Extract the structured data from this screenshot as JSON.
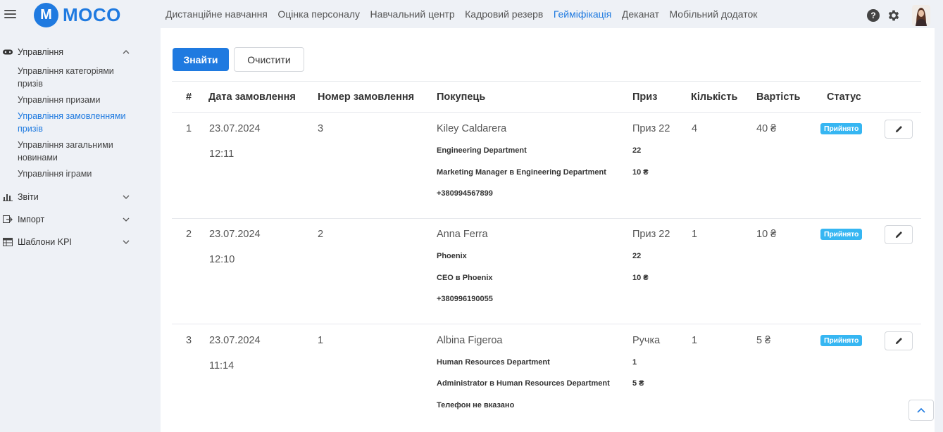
{
  "app": {
    "logo_letter": "M",
    "logo_text": "MOCO"
  },
  "topnav": [
    {
      "label": "Дистанційне навчання",
      "active": false
    },
    {
      "label": "Оцінка персоналу",
      "active": false
    },
    {
      "label": "Навчальний центр",
      "active": false
    },
    {
      "label": "Кадровий резерв",
      "active": false
    },
    {
      "label": "Гейміфікація",
      "active": true
    },
    {
      "label": "Деканат",
      "active": false
    },
    {
      "label": "Мобільний додаток",
      "active": false
    }
  ],
  "top_icons": {
    "help": "?"
  },
  "sidebar": {
    "management": {
      "label": "Управління",
      "items": [
        "Управління категоріями призів",
        "Управління призами",
        "Управління замовленнями призів",
        "Управління загальними новинами",
        "Управління іграми"
      ]
    },
    "reports": "Звіти",
    "import": "Імпорт",
    "kpi": "Шаблони KPI"
  },
  "filters": {
    "find_label": "Знайти",
    "clear_label": "Очистити"
  },
  "table": {
    "headers": [
      "#",
      "Дата замовлення",
      "Номер замовлення",
      "Покупець",
      "Приз",
      "Кількість",
      "Вартість",
      "Статус"
    ],
    "rows": [
      {
        "num": "1",
        "date": "23.07.2024",
        "time": "12:11",
        "order": "3",
        "buyer": "Kiley Caldarera",
        "dept": "Engineering Department",
        "position": "Marketing Manager в Engineering Department",
        "phone": "+380994567899",
        "prize": "Приз 22",
        "prize_sub1": "22",
        "prize_sub2": "10 ₴",
        "qty": "4",
        "cost": "40 ₴",
        "status": "Прийнято"
      },
      {
        "num": "2",
        "date": "23.07.2024",
        "time": "12:10",
        "order": "2",
        "buyer": "Anna Ferra",
        "dept": "Phoenix",
        "position": "CEO в Phoenix",
        "phone": "+380996190055",
        "prize": "Приз 22",
        "prize_sub1": "22",
        "prize_sub2": "10 ₴",
        "qty": "1",
        "cost": "10 ₴",
        "status": "Прийнято"
      },
      {
        "num": "3",
        "date": "23.07.2024",
        "time": "11:14",
        "order": "1",
        "buyer": "Albina Figeroa",
        "dept": "Human Resources Department",
        "position": "Administrator в Human Resources Department",
        "phone": "Телефон не вказано",
        "prize": "Ручка",
        "prize_sub1": "1",
        "prize_sub2": "5 ₴",
        "qty": "1",
        "cost": "5 ₴",
        "status": "Прийнято"
      }
    ]
  },
  "colors": {
    "accent": "#1f7ae0",
    "badge": "#36b6f2",
    "background": "#eef1f6"
  }
}
